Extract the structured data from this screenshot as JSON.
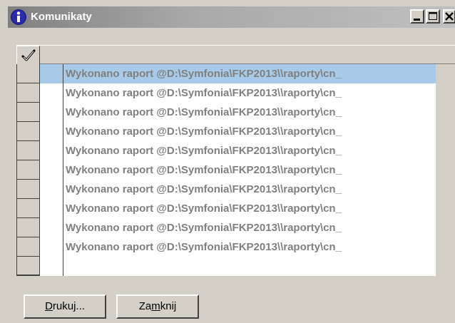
{
  "window": {
    "title": "Komunikaty",
    "title_icon": "info-icon",
    "accent": "#808080"
  },
  "titlebar_buttons": {
    "minimize": "minimize-icon",
    "maximize": "maximize-icon",
    "close": "close-icon"
  },
  "grid": {
    "header_icon": "checkmark-icon",
    "rows": [
      {
        "text": "Wykonano raport @D:\\Symfonia\\FKP2013\\\\raporty\\cn_",
        "selected": true
      },
      {
        "text": "Wykonano raport @D:\\Symfonia\\FKP2013\\\\raporty\\cn_",
        "selected": false
      },
      {
        "text": "Wykonano raport @D:\\Symfonia\\FKP2013\\\\raporty\\cn_",
        "selected": false
      },
      {
        "text": "Wykonano raport @D:\\Symfonia\\FKP2013\\\\raporty\\cn_",
        "selected": false
      },
      {
        "text": "Wykonano raport @D:\\Symfonia\\FKP2013\\\\raporty\\cn_",
        "selected": false
      },
      {
        "text": "Wykonano raport @D:\\Symfonia\\FKP2013\\\\raporty\\cn_",
        "selected": false
      },
      {
        "text": "Wykonano raport @D:\\Symfonia\\FKP2013\\\\raporty\\cn_",
        "selected": false
      },
      {
        "text": "Wykonano raport @D:\\Symfonia\\FKP2013\\\\raporty\\cn_",
        "selected": false
      },
      {
        "text": "Wykonano raport @D:\\Symfonia\\FKP2013\\\\raporty\\cn_",
        "selected": false
      },
      {
        "text": "Wykonano raport @D:\\Symfonia\\FKP2013\\\\raporty\\cn_",
        "selected": false
      }
    ],
    "selection_color": "#a6cae8"
  },
  "buttons": {
    "print": {
      "pre": "",
      "mnemonic": "D",
      "post": "rukuj..."
    },
    "close": {
      "pre": "Za",
      "mnemonic": "m",
      "post": "knij"
    }
  }
}
